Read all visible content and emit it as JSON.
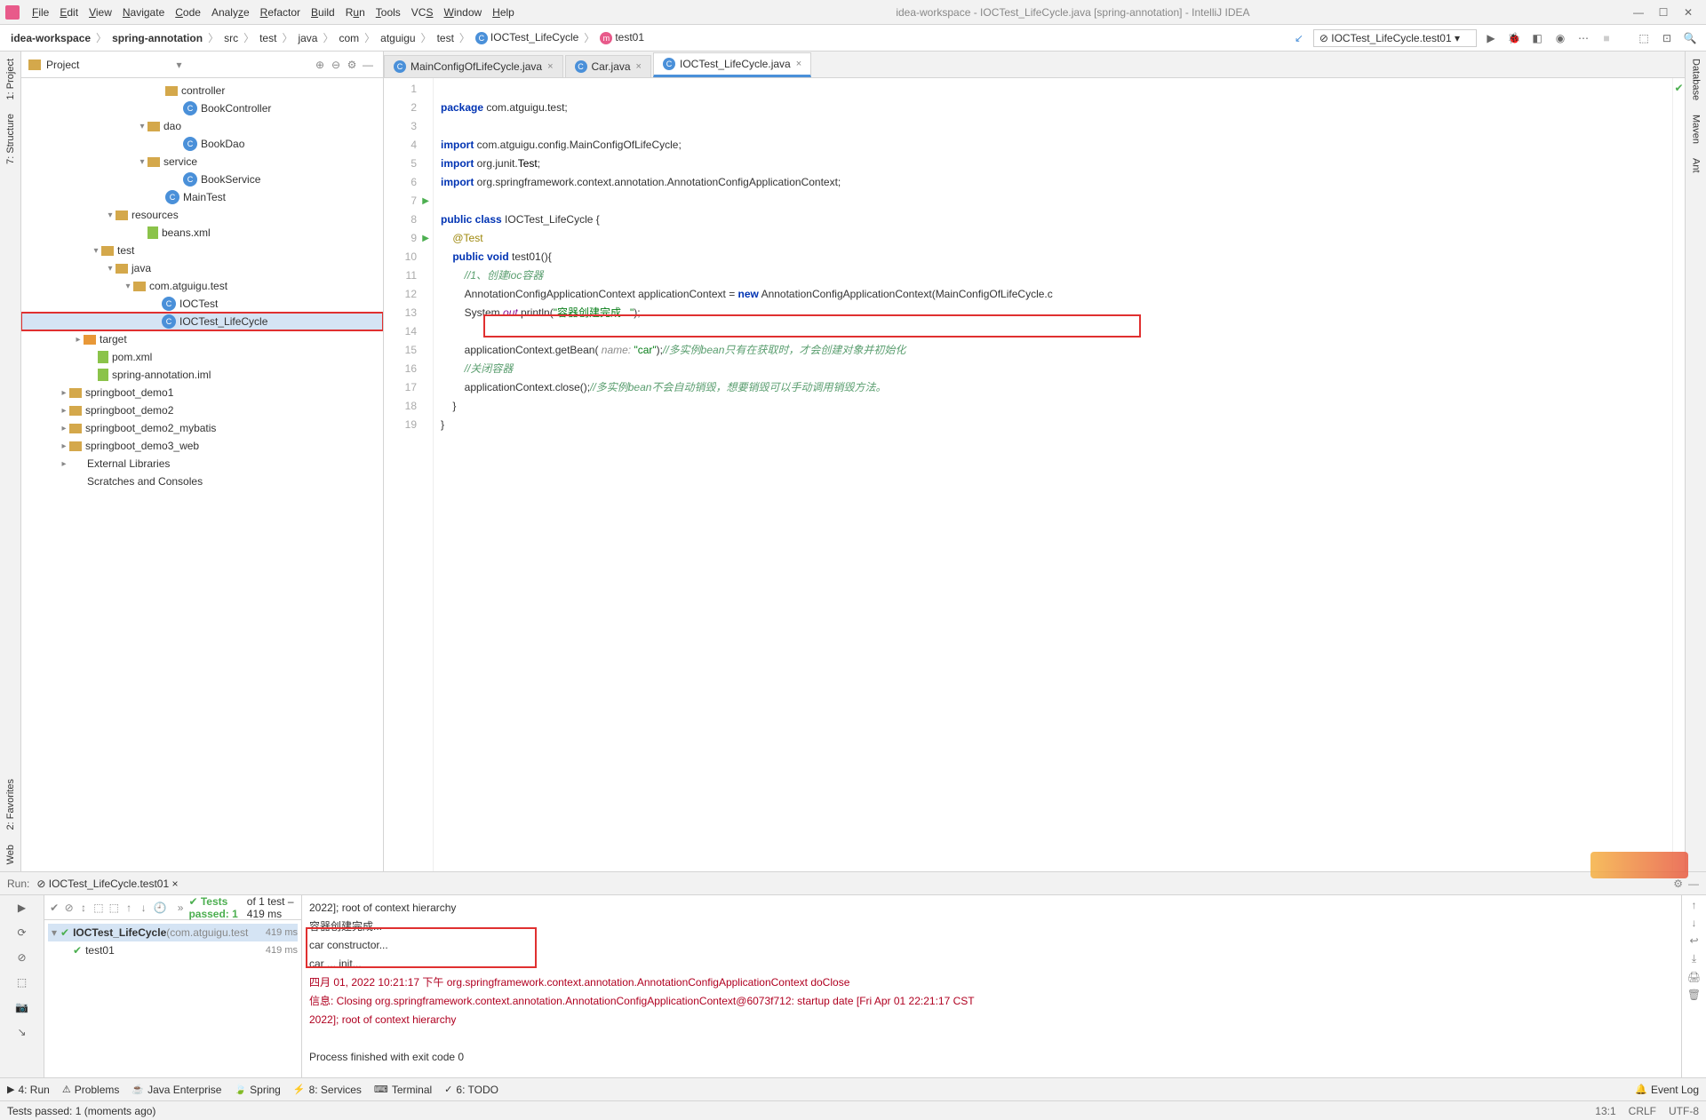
{
  "menubar": {
    "items": [
      "File",
      "Edit",
      "View",
      "Navigate",
      "Code",
      "Analyze",
      "Refactor",
      "Build",
      "Run",
      "Tools",
      "VCS",
      "Window",
      "Help"
    ],
    "title": "idea-workspace - IOCTest_LifeCycle.java [spring-annotation] - IntelliJ IDEA"
  },
  "breadcrumb": {
    "parts": [
      "idea-workspace",
      "spring-annotation",
      "src",
      "test",
      "java",
      "com",
      "atguigu",
      "test",
      "IOCTest_LifeCycle",
      "test01"
    ],
    "runconfig": "IOCTest_LifeCycle.test01"
  },
  "project": {
    "title": "Project",
    "nodes": [
      {
        "pad": 150,
        "arrow": "",
        "ic": "folder",
        "label": "controller"
      },
      {
        "pad": 170,
        "arrow": "",
        "ic": "class",
        "label": "BookController"
      },
      {
        "pad": 130,
        "arrow": "▾",
        "ic": "folder",
        "label": "dao"
      },
      {
        "pad": 170,
        "arrow": "",
        "ic": "class",
        "label": "BookDao"
      },
      {
        "pad": 130,
        "arrow": "▾",
        "ic": "folder",
        "label": "service"
      },
      {
        "pad": 170,
        "arrow": "",
        "ic": "class",
        "label": "BookService"
      },
      {
        "pad": 150,
        "arrow": "",
        "ic": "class",
        "label": "MainTest"
      },
      {
        "pad": 94,
        "arrow": "▾",
        "ic": "folder",
        "label": "resources"
      },
      {
        "pad": 130,
        "arrow": "",
        "ic": "xml",
        "label": "beans.xml"
      },
      {
        "pad": 78,
        "arrow": "▾",
        "ic": "folder",
        "label": "test"
      },
      {
        "pad": 94,
        "arrow": "▾",
        "ic": "folder",
        "label": "java"
      },
      {
        "pad": 114,
        "arrow": "▾",
        "ic": "folder",
        "label": "com.atguigu.test"
      },
      {
        "pad": 146,
        "arrow": "",
        "ic": "class",
        "label": "IOCTest"
      },
      {
        "pad": 146,
        "arrow": "",
        "ic": "class",
        "label": "IOCTest_LifeCycle",
        "sel": true,
        "hl": true
      },
      {
        "pad": 58,
        "arrow": "▸",
        "ic": "target",
        "label": "target"
      },
      {
        "pad": 74,
        "arrow": "",
        "ic": "xml",
        "label": "pom.xml"
      },
      {
        "pad": 74,
        "arrow": "",
        "ic": "xml",
        "label": "spring-annotation.iml"
      },
      {
        "pad": 42,
        "arrow": "▸",
        "ic": "folder",
        "label": "springboot_demo1"
      },
      {
        "pad": 42,
        "arrow": "▸",
        "ic": "folder",
        "label": "springboot_demo2"
      },
      {
        "pad": 42,
        "arrow": "▸",
        "ic": "folder",
        "label": "springboot_demo2_mybatis"
      },
      {
        "pad": 42,
        "arrow": "▸",
        "ic": "folder",
        "label": "springboot_demo3_web"
      },
      {
        "pad": 42,
        "arrow": "▸",
        "ic": "lib",
        "label": "External Libraries"
      },
      {
        "pad": 42,
        "arrow": "",
        "ic": "lib",
        "label": "Scratches and Consoles"
      }
    ]
  },
  "tabs": [
    {
      "label": "MainConfigOfLifeCycle.java",
      "active": false
    },
    {
      "label": "Car.java",
      "active": false
    },
    {
      "label": "IOCTest_LifeCycle.java",
      "active": true
    }
  ],
  "gutter": [
    "1",
    "2",
    "3",
    "4",
    "5",
    "6",
    "7",
    "8",
    "9",
    "10",
    "11",
    "12",
    "13",
    "14",
    "15",
    "16",
    "17",
    "18",
    "19"
  ],
  "code": {
    "l1": "package",
    "l1b": " com.atguigu.test;",
    "l3": "import",
    "l3b": " com.atguigu.config.MainConfigOfLifeCycle;",
    "l4": "import",
    "l4b": " org.junit.",
    "l4c": "Test",
    "l4d": ";",
    "l5": "import",
    "l5b": " org.springframework.context.annotation.AnnotationConfigApplicationContext;",
    "l7a": "public class",
    "l7b": " IOCTest_LifeCycle {",
    "l8": "    @Test",
    "l9a": "    public void",
    "l9b": " test01(){",
    "l10": "        //1、创建ioc容器",
    "l11a": "        AnnotationConfigApplicationContext applicationContext = ",
    "l11b": "new",
    "l11c": " AnnotationConfigApplicationContext(MainConfigOfLifeCycle.c",
    "l12a": "        System.",
    "l12b": "out",
    "l12c": ".println(",
    "l12d": "\"容器创建完成...\"",
    "l12e": ");",
    "l14a": "        applicationContext.getBean( ",
    "l14b": "name:",
    "l14c": " \"car\"",
    "l14d": ");",
    "l14e": "//多实例bean只有在获取时，才会创建对象并初始化",
    "l15": "        //关闭容器",
    "l16a": "        applicationContext.close();",
    "l16b": "//多实例bean不会自动销毁，想要销毁可以手动调用销毁方法。",
    "l17": "    }",
    "l18": "}"
  },
  "run": {
    "label": "Run:",
    "tab": "IOCTest_LifeCycle.test01",
    "tests_msg": "Tests passed: 1",
    "tests_tail": " of 1 test – 419 ms",
    "tree_root": "IOCTest_LifeCycle",
    "tree_pkg": "(com.atguigu.test",
    "tree_time1": "419 ms",
    "tree_leaf": "test01",
    "tree_time2": "419 ms"
  },
  "console": [
    {
      "cls": "",
      "txt": "  2022]; root of context hierarchy"
    },
    {
      "cls": "",
      "txt": "容器创建完成..."
    },
    {
      "cls": "",
      "txt": "car constructor..."
    },
    {
      "cls": "",
      "txt": "car ... init..."
    },
    {
      "cls": "info",
      "txt": "四月 01, 2022 10:21:17 下午 org.springframework.context.annotation.AnnotationConfigApplicationContext doClose"
    },
    {
      "cls": "info",
      "txt": "信息: Closing org.springframework.context.annotation.AnnotationConfigApplicationContext@6073f712: startup date [Fri Apr 01 22:21:17 CST"
    },
    {
      "cls": "info",
      "txt": "  2022]; root of context hierarchy"
    },
    {
      "cls": "",
      "txt": ""
    },
    {
      "cls": "",
      "txt": "Process finished with exit code 0"
    }
  ],
  "bottombar": {
    "items": [
      "4: Run",
      "Problems",
      "Java Enterprise",
      "Spring",
      "8: Services",
      "Terminal",
      "6: TODO"
    ],
    "event": "Event Log"
  },
  "status": {
    "msg": "Tests passed: 1 (moments ago)",
    "pos": "13:1",
    "enc": "CRLF",
    "cs": "UTF-8"
  },
  "sidebars": {
    "left": [
      "1: Project",
      "7: Structure",
      "2: Favorites",
      "Web"
    ],
    "right": [
      "Database",
      "Maven",
      "Ant"
    ]
  }
}
